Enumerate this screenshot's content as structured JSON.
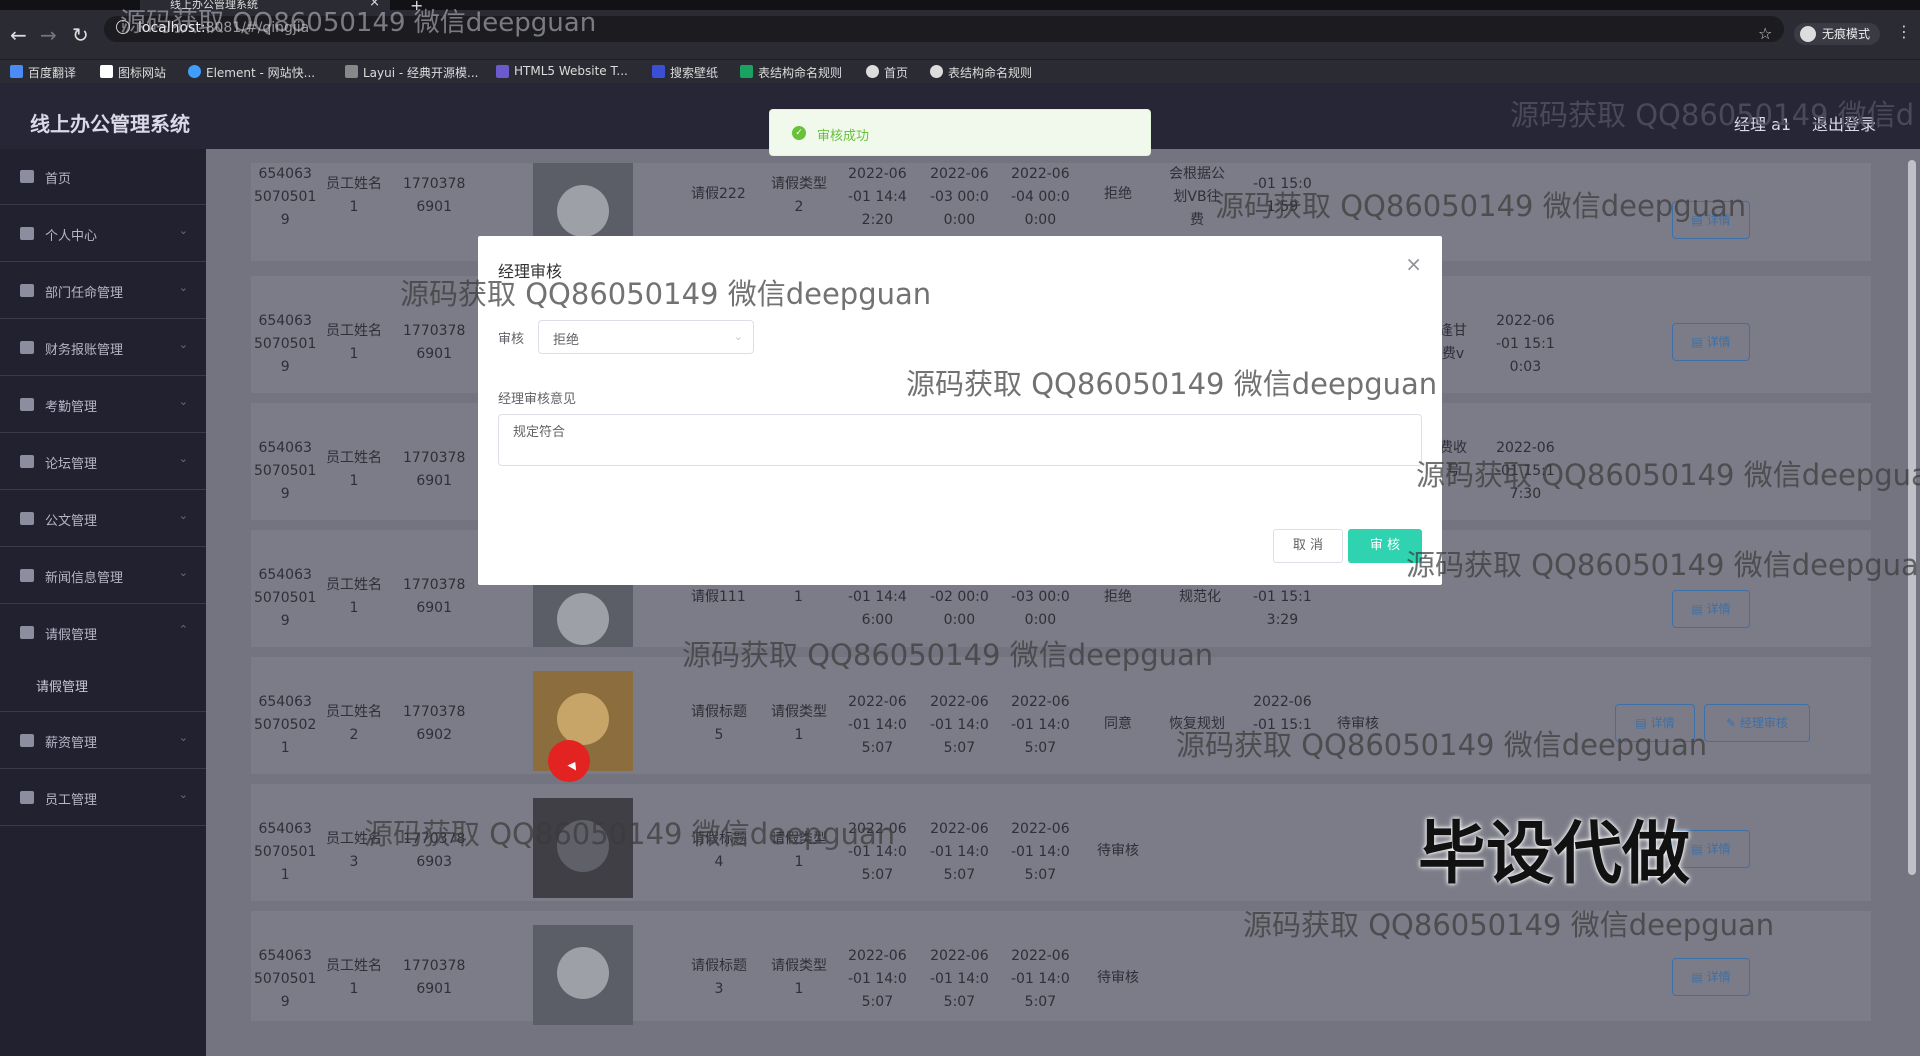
{
  "browser": {
    "tab_title": "线上办公管理系统",
    "url_host": "localhost:",
    "url_rest": "8081/#/qingjia",
    "incognito_label": "无痕模式",
    "bookmarks": [
      "百度翻译",
      "图标网站",
      "Element - 网站快...",
      "Layui - 经典开源模...",
      "HTML5 Website T...",
      "搜索壁纸",
      "表结构命名规则",
      "首页",
      "表结构命名规则"
    ]
  },
  "header": {
    "app_title": "线上办公管理系统",
    "user": "经理 a1",
    "logout": "退出登录"
  },
  "sidebar": {
    "items": [
      "首页",
      "个人中心",
      "部门任命管理",
      "财务报账管理",
      "考勤管理",
      "论坛管理",
      "公文管理",
      "新闻信息管理",
      "请假管理",
      "薪资管理",
      "员工管理"
    ],
    "submenu": "请假管理"
  },
  "toast": "审核成功",
  "dialog": {
    "title": "经理审核",
    "audit_label": "审核",
    "audit_value": "拒绝",
    "opinion_label": "经理审核意见",
    "opinion_value": "规定符合",
    "cancel": "取 消",
    "confirm": "审 核"
  },
  "table": {
    "rows": [
      {
        "id": "654063\n5070501\n9",
        "name": "员工姓名\n1",
        "phone": "1770378\n6901",
        "title": "请假222",
        "type": "请假类型\n2",
        "d1": "2022-06\n-01 14:4\n2:20",
        "d2": "2022-06\n-03 00:0\n0:00",
        "d3": "2022-06\n-04 00:0\n0:00",
        "status": "拒绝",
        "opinion": "会根据公\n划VB往\n费",
        "time": "-01 15:0\n1:59"
      },
      {
        "id": "654063\n5070501\n9",
        "name": "员工姓名\n1",
        "phone": "1770378\n6901",
        "opinion": "逢甘\n费v",
        "time": "2022-06\n-01 15:1\n0:03"
      },
      {
        "id": "654063\n5070501\n9",
        "name": "员工姓名\n1",
        "phone": "1770378\n6901",
        "opinion": "费收\n号",
        "time": "2022-06\n-01 15:1\n7:30"
      },
      {
        "id": "654063\n5070501\n9",
        "name": "员工姓名\n1",
        "phone": "1770378\n6901",
        "title": "请假111",
        "type": "1",
        "d1": "-01 14:4\n6:00",
        "d2": "-02 00:0\n0:00",
        "d3": "-03 00:0\n0:00",
        "status": "拒绝",
        "opinion": "规范化",
        "time": "-01 15:1\n3:29"
      },
      {
        "id": "654063\n5070502\n1",
        "name": "员工姓名\n2",
        "phone": "1770378\n6902",
        "title": "请假标题\n5",
        "type": "请假类型\n1",
        "d1": "2022-06\n-01 14:0\n5:07",
        "d2": "2022-06\n-01 14:0\n5:07",
        "d3": "2022-06\n-01 14:0\n5:07",
        "status": "同意",
        "opinion": "恢复规划",
        "time": "2022-06\n-01 15:1",
        "pending": "待审核"
      },
      {
        "id": "654063\n5070501\n1",
        "name": "员工姓名\n3",
        "phone": "1770378\n6903",
        "title": "请假标题\n4",
        "type": "请假类型\n1",
        "d1": "2022-06\n-01 14:0\n5:07",
        "d2": "2022-06\n-01 14:0\n5:07",
        "d3": "2022-06\n-01 14:0\n5:07",
        "status": "待审核"
      },
      {
        "id": "654063\n5070501\n9",
        "name": "员工姓名\n1",
        "phone": "1770378\n6901",
        "title": "请假标题\n3",
        "type": "请假类型\n1",
        "d1": "2022-06\n-01 14:0\n5:07",
        "d2": "2022-06\n-01 14:0\n5:07",
        "d3": "2022-06\n-01 14:0\n5:07",
        "status": "待审核"
      }
    ],
    "detail_btn": "详情",
    "audit_btn": "经理审核"
  },
  "watermarks": {
    "qq": "源码获取 QQ86050149 微信deepguan",
    "qq_trunc": "源码获取 QQ86050149 微信deepgua",
    "qq_short": "源码获取 QQ86050149 微信d",
    "big": "毕设代做"
  }
}
